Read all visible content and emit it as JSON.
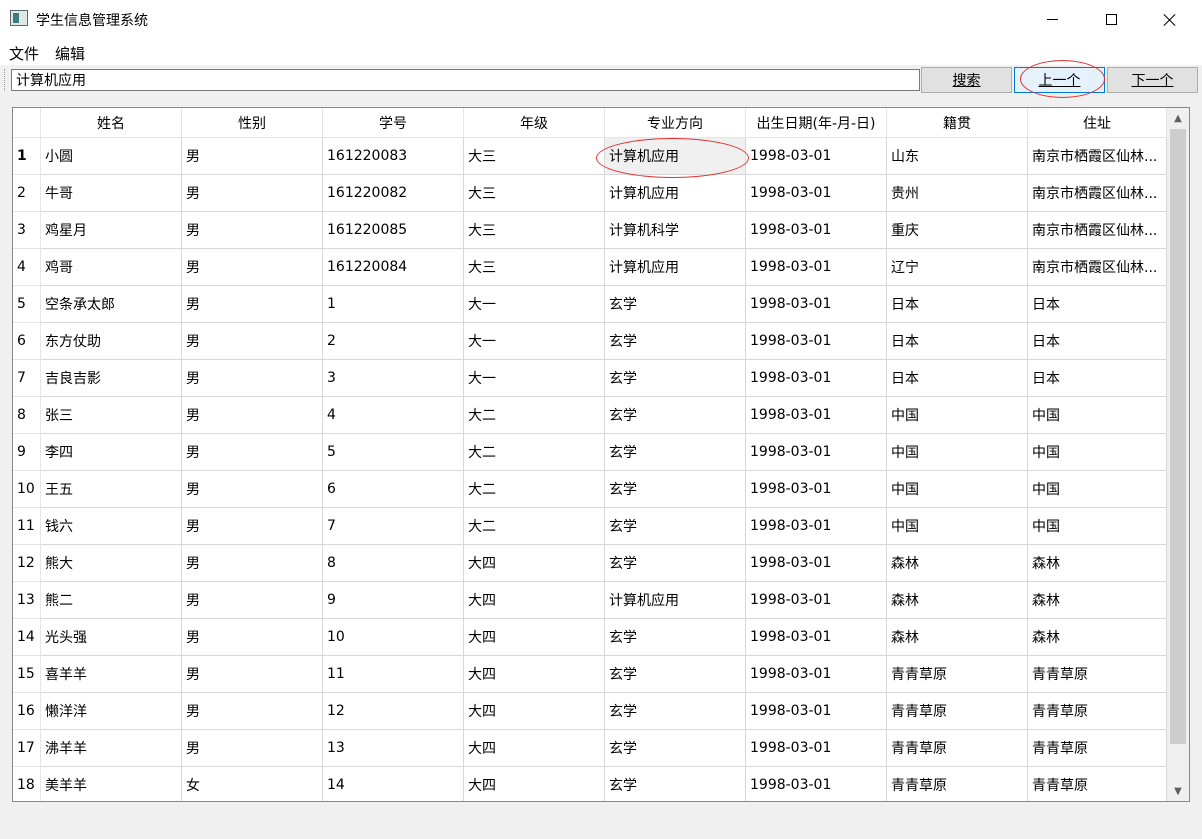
{
  "window": {
    "title": "学生信息管理系统",
    "icon": "app-window-icon",
    "minimize_icon": "minimize-icon",
    "maximize_icon": "maximize-icon",
    "close_icon": "close-icon"
  },
  "menu": {
    "file": "文件",
    "edit": "编辑"
  },
  "toolbar": {
    "search_value": "计算机应用",
    "search_label": "搜索",
    "prev_label": "上一个",
    "next_label": "下一个"
  },
  "table": {
    "columns": [
      "姓名",
      "性别",
      "学号",
      "年级",
      "专业方向",
      "出生日期(年-月-日)",
      "籍贯",
      "住址"
    ],
    "rows": [
      {
        "num": "1",
        "cells": [
          "小圆",
          "男",
          "161220083",
          "大三",
          "计算机应用",
          "1998-03-01",
          "山东",
          "南京市栖霞区仙林..."
        ]
      },
      {
        "num": "2",
        "cells": [
          "牛哥",
          "男",
          "161220082",
          "大三",
          "计算机应用",
          "1998-03-01",
          "贵州",
          "南京市栖霞区仙林..."
        ]
      },
      {
        "num": "3",
        "cells": [
          "鸡星月",
          "男",
          "161220085",
          "大三",
          "计算机科学",
          "1998-03-01",
          "重庆",
          "南京市栖霞区仙林..."
        ]
      },
      {
        "num": "4",
        "cells": [
          "鸡哥",
          "男",
          "161220084",
          "大三",
          "计算机应用",
          "1998-03-01",
          "辽宁",
          "南京市栖霞区仙林..."
        ]
      },
      {
        "num": "5",
        "cells": [
          "空条承太郎",
          "男",
          "1",
          "大一",
          "玄学",
          "1998-03-01",
          "日本",
          "日本"
        ]
      },
      {
        "num": "6",
        "cells": [
          "东方仗助",
          "男",
          "2",
          "大一",
          "玄学",
          "1998-03-01",
          "日本",
          "日本"
        ]
      },
      {
        "num": "7",
        "cells": [
          "吉良吉影",
          "男",
          "3",
          "大一",
          "玄学",
          "1998-03-01",
          "日本",
          "日本"
        ]
      },
      {
        "num": "8",
        "cells": [
          "张三",
          "男",
          "4",
          "大二",
          "玄学",
          "1998-03-01",
          "中国",
          "中国"
        ]
      },
      {
        "num": "9",
        "cells": [
          "李四",
          "男",
          "5",
          "大二",
          "玄学",
          "1998-03-01",
          "中国",
          "中国"
        ]
      },
      {
        "num": "10",
        "cells": [
          "王五",
          "男",
          "6",
          "大二",
          "玄学",
          "1998-03-01",
          "中国",
          "中国"
        ]
      },
      {
        "num": "11",
        "cells": [
          "钱六",
          "男",
          "7",
          "大二",
          "玄学",
          "1998-03-01",
          "中国",
          "中国"
        ]
      },
      {
        "num": "12",
        "cells": [
          "熊大",
          "男",
          "8",
          "大四",
          "玄学",
          "1998-03-01",
          "森林",
          "森林"
        ]
      },
      {
        "num": "13",
        "cells": [
          "熊二",
          "男",
          "9",
          "大四",
          "计算机应用",
          "1998-03-01",
          "森林",
          "森林"
        ]
      },
      {
        "num": "14",
        "cells": [
          "光头强",
          "男",
          "10",
          "大四",
          "玄学",
          "1998-03-01",
          "森林",
          "森林"
        ]
      },
      {
        "num": "15",
        "cells": [
          "喜羊羊",
          "男",
          "11",
          "大四",
          "玄学",
          "1998-03-01",
          "青青草原",
          "青青草原"
        ]
      },
      {
        "num": "16",
        "cells": [
          "懒洋洋",
          "男",
          "12",
          "大四",
          "玄学",
          "1998-03-01",
          "青青草原",
          "青青草原"
        ]
      },
      {
        "num": "17",
        "cells": [
          "沸羊羊",
          "男",
          "13",
          "大四",
          "玄学",
          "1998-03-01",
          "青青草原",
          "青青草原"
        ]
      },
      {
        "num": "18",
        "cells": [
          "美羊羊",
          "女",
          "14",
          "大四",
          "玄学",
          "1998-03-01",
          "青青草原",
          "青青草原"
        ]
      }
    ]
  },
  "scrollbar": {
    "up_icon": "scroll-up-arrow-icon",
    "down_icon": "scroll-down-arrow-icon"
  },
  "colors": {
    "annotation": "#e03030",
    "active_button_border": "#0078d7"
  }
}
